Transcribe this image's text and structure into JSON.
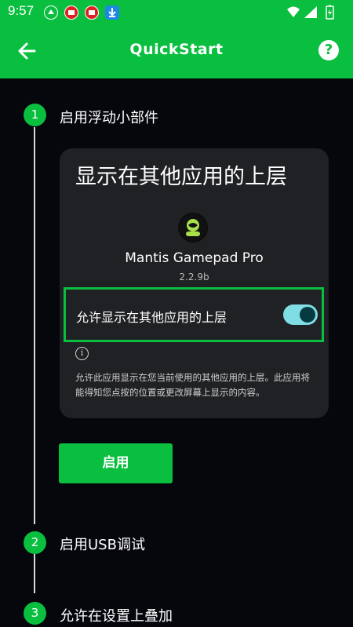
{
  "status": {
    "time": "9:57",
    "icons": [
      "mantis-notification-icon",
      "app-notification-icon",
      "app-notification-icon",
      "download-icon",
      "wifi-icon",
      "signal-icon",
      "battery-icon"
    ]
  },
  "app_bar": {
    "title": "QuickStart",
    "back_icon": "arrow-left-icon",
    "help_label": "?"
  },
  "steps": [
    {
      "number": "1",
      "label": "启用浮动小部件"
    },
    {
      "number": "2",
      "label": "启用USB调试"
    },
    {
      "number": "3",
      "label": "允许在设置上叠加"
    }
  ],
  "card": {
    "title": "显示在其他应用的上层",
    "app_name": "Mantis Gamepad Pro",
    "app_version": "2.2.9b",
    "toggle_label": "允许显示在其他应用的上层",
    "toggle_on": true,
    "info_icon_label": "i",
    "description": "允许此应用显示在您当前使用的其他应用的上层。此应用将能得知您点按的位置或更改屏幕上显示的内容。"
  },
  "enable_button": {
    "label": "启用"
  },
  "colors": {
    "accent": "#0abf3f",
    "background": "#06070c",
    "card": "#202124",
    "toggle_track": "#80dde4",
    "toggle_knob": "#053a40"
  }
}
